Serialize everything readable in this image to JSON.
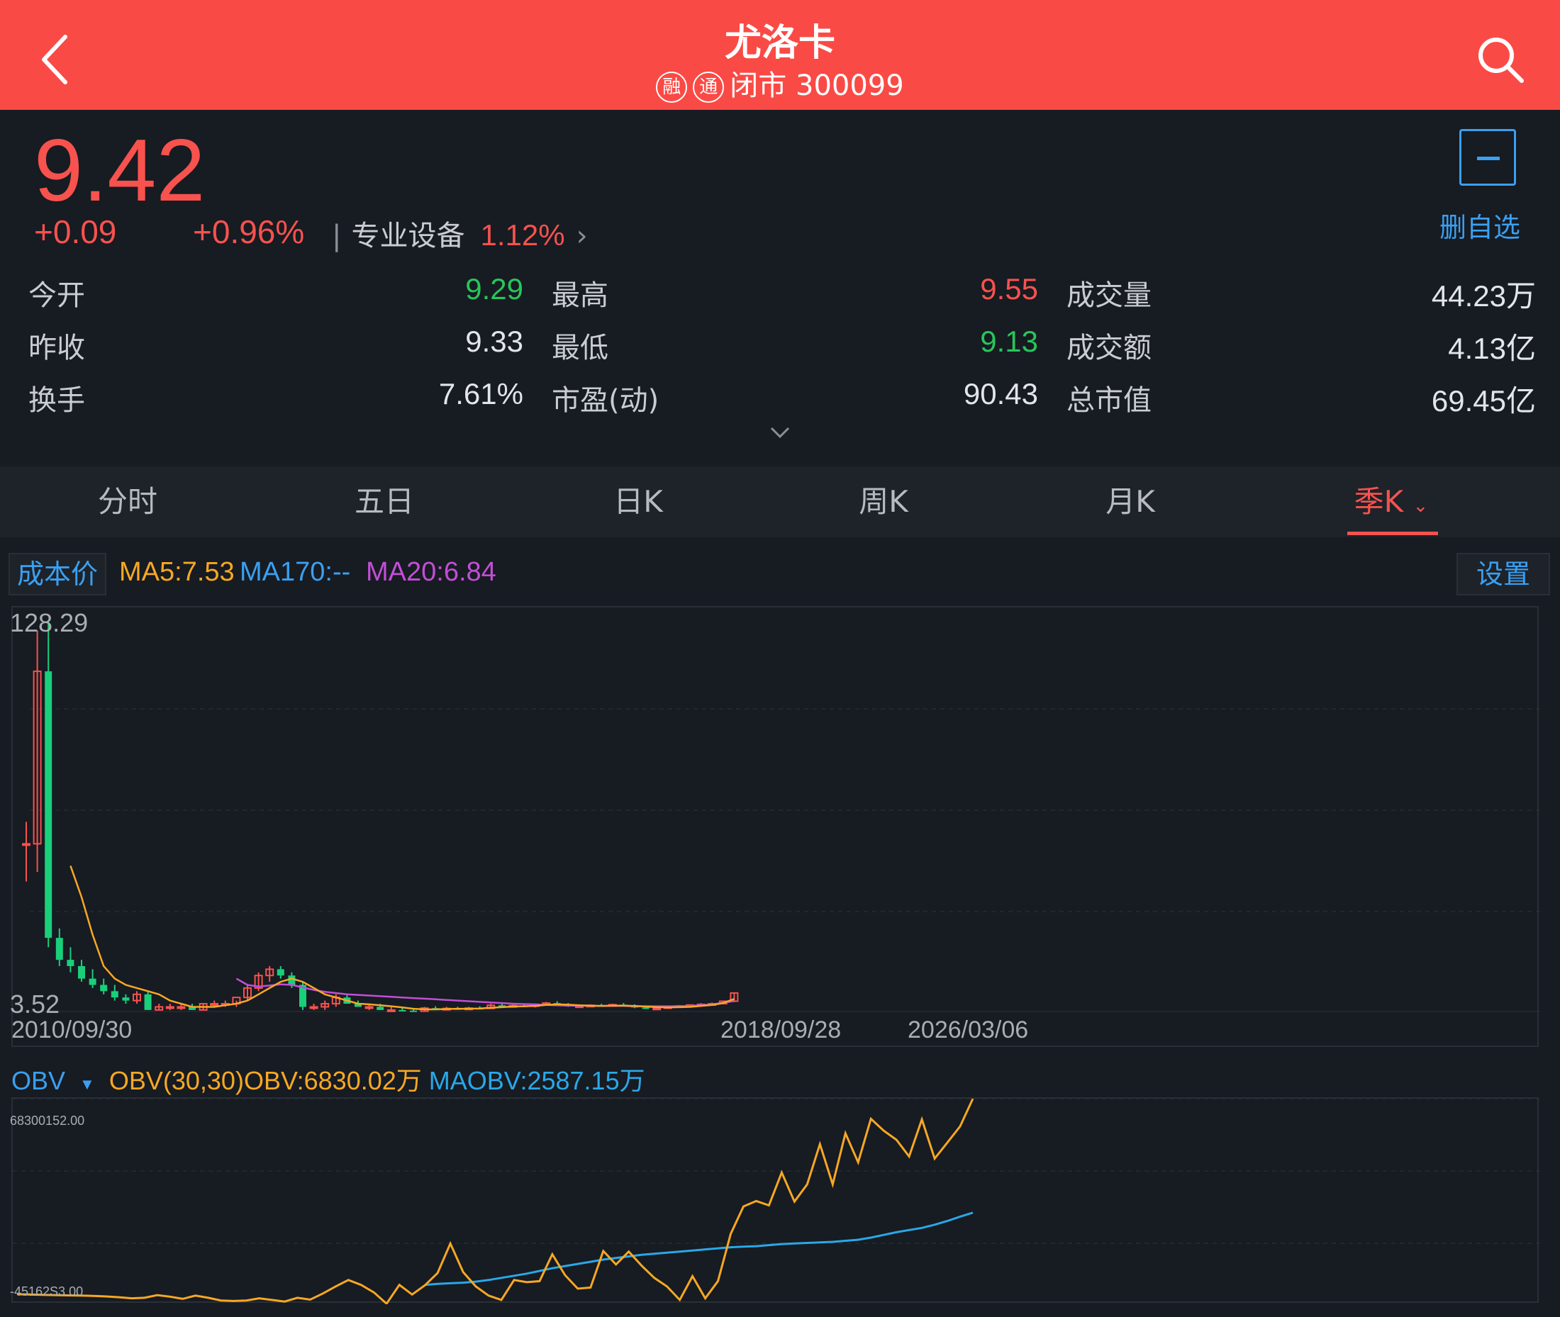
{
  "header": {
    "title": "尤洛卡",
    "badge1": "融",
    "badge2": "通",
    "subtitle": "闭市 300099"
  },
  "quote": {
    "price": "9.42",
    "change": "+0.09",
    "change_pct": "+0.96%",
    "sector_name": "专业设备",
    "sector_pct": "1.12%",
    "watch_label": "删自选"
  },
  "stats": [
    {
      "label": "今开",
      "value": "9.29",
      "color": "green"
    },
    {
      "label": "最高",
      "value": "9.55",
      "color": "red"
    },
    {
      "label": "成交量",
      "value": "44.23万",
      "color": "white"
    },
    {
      "label": "昨收",
      "value": "9.33",
      "color": "white"
    },
    {
      "label": "最低",
      "value": "9.13",
      "color": "green"
    },
    {
      "label": "成交额",
      "value": "4.13亿",
      "color": "white"
    },
    {
      "label": "换手",
      "value": "7.61%",
      "color": "white"
    },
    {
      "label": "市盈(动)",
      "value": "90.43",
      "color": "white"
    },
    {
      "label": "总市值",
      "value": "69.45亿",
      "color": "white"
    }
  ],
  "tabs": [
    "分时",
    "五日",
    "日K",
    "周K",
    "月K",
    "季K"
  ],
  "active_tab": "季K",
  "indicators": {
    "cost_label": "成本价",
    "ma5": "MA5:7.53",
    "ma170": "MA170:--",
    "ma20": "MA20:6.84",
    "settings_label": "设置"
  },
  "colors": {
    "up": "#f7524d",
    "down": "#19cf7a",
    "ma5": "#f7a823",
    "ma20": "#c24ed6",
    "obv": "#f7a823",
    "maobv": "#29a8e8",
    "accent": "#3aa0f0",
    "header": "#fa4a45"
  },
  "chart_data": [
    {
      "type": "candlestick",
      "ymax_label": "128.29",
      "ymin_label": "3.52",
      "ylim": [
        3.52,
        128.29
      ],
      "x_labels": [
        "2010/09/30",
        "2018/09/28",
        "2026/03/06"
      ],
      "candles": [
        [
          57,
          64,
          45,
          57
        ],
        [
          57,
          125,
          48,
          112
        ],
        [
          112,
          128.29,
          24,
          27
        ],
        [
          27,
          30,
          18,
          20
        ],
        [
          20,
          24,
          16,
          18
        ],
        [
          18,
          20,
          13,
          14
        ],
        [
          14,
          17,
          11,
          12
        ],
        [
          12,
          14,
          9,
          10
        ],
        [
          10,
          12,
          7,
          8
        ],
        [
          8,
          9,
          6,
          7
        ],
        [
          7,
          10,
          6,
          9
        ],
        [
          9,
          10,
          4,
          4
        ],
        [
          4,
          6,
          4,
          5
        ],
        [
          5,
          6,
          4,
          5
        ],
        [
          5,
          6,
          4,
          5
        ],
        [
          5,
          6,
          4,
          4
        ],
        [
          4,
          6,
          4,
          6
        ],
        [
          6,
          7,
          5,
          6
        ],
        [
          6,
          7,
          5,
          6
        ],
        [
          6,
          7,
          5,
          8
        ],
        [
          8,
          12,
          7,
          11
        ],
        [
          11,
          16,
          10,
          15
        ],
        [
          15,
          18,
          13,
          17
        ],
        [
          17,
          18,
          14,
          15
        ],
        [
          15,
          16,
          11,
          12
        ],
        [
          12,
          13,
          4,
          5
        ],
        [
          5,
          6,
          4,
          5
        ],
        [
          5,
          7,
          4,
          6
        ],
        [
          6,
          9,
          5,
          8
        ],
        [
          8,
          9,
          6,
          6
        ],
        [
          6,
          7,
          5,
          5
        ],
        [
          5,
          6,
          4,
          5
        ],
        [
          5,
          6,
          4,
          4
        ],
        [
          4,
          5,
          3.6,
          4
        ],
        [
          4,
          5,
          3.6,
          3.8
        ],
        [
          3.8,
          4.2,
          3.52,
          3.6
        ],
        [
          3.6,
          5,
          3.6,
          4.6
        ],
        [
          4.6,
          5.2,
          4.2,
          4.4
        ],
        [
          4.4,
          5,
          4,
          4.5
        ],
        [
          4.5,
          5,
          4.2,
          4.3
        ],
        [
          4.3,
          5,
          4.2,
          4.6
        ],
        [
          4.6,
          5.2,
          4.3,
          4.5
        ],
        [
          4.5,
          6,
          4.3,
          5.5
        ],
        [
          5.5,
          6.5,
          5,
          5.2
        ],
        [
          5.2,
          6.2,
          5,
          5.4
        ],
        [
          5.4,
          6,
          5,
          5.2
        ],
        [
          5.2,
          6,
          4.8,
          5.8
        ],
        [
          5.8,
          6.6,
          5.4,
          6.2
        ],
        [
          6.2,
          6.8,
          5.6,
          5.8
        ],
        [
          5.8,
          6.2,
          5,
          5.1
        ],
        [
          5.1,
          5.6,
          4.8,
          5.3
        ],
        [
          5.3,
          5.8,
          5,
          5.5
        ],
        [
          5.5,
          6,
          5.2,
          5.4
        ],
        [
          5.4,
          6,
          5.1,
          5.7
        ],
        [
          5.7,
          6.2,
          5.2,
          5.3
        ],
        [
          5.3,
          5.8,
          4.6,
          4.8
        ],
        [
          4.8,
          5.2,
          4.3,
          4.5
        ],
        [
          4.5,
          5,
          4.3,
          4.6
        ],
        [
          4.6,
          5.2,
          4.4,
          5.0
        ],
        [
          5.0,
          5.6,
          4.8,
          5.3
        ],
        [
          5.3,
          5.8,
          5.0,
          5.6
        ],
        [
          5.6,
          6.2,
          5.2,
          5.8
        ],
        [
          5.8,
          6.4,
          5.6,
          6.0
        ],
        [
          6.0,
          7.0,
          5.8,
          6.8
        ],
        [
          6.8,
          9.55,
          6.5,
          9.42
        ]
      ],
      "ma5": [
        null,
        null,
        null,
        null,
        50,
        40,
        28,
        18,
        14,
        12,
        11,
        10,
        9,
        7,
        6,
        5,
        5,
        5,
        5.5,
        6,
        7,
        9,
        11,
        13,
        14,
        13,
        11,
        9,
        8,
        7,
        6,
        5.8,
        5.5,
        5.2,
        4.8,
        4.4,
        4.2,
        4.2,
        4.3,
        4.4,
        4.4,
        4.5,
        4.7,
        4.9,
        5.1,
        5.2,
        5.3,
        5.6,
        5.8,
        5.7,
        5.5,
        5.4,
        5.3,
        5.4,
        5.4,
        5.3,
        5.1,
        4.9,
        4.8,
        4.9,
        5.0,
        5.3,
        5.6,
        6.2,
        7.53
      ],
      "ma20": [
        null,
        null,
        null,
        null,
        null,
        null,
        null,
        null,
        null,
        null,
        null,
        null,
        null,
        null,
        null,
        null,
        null,
        null,
        null,
        14,
        12,
        11.5,
        11.8,
        12.2,
        12,
        11.2,
        10.4,
        9.8,
        9.4,
        9.0,
        8.8,
        8.6,
        8.4,
        8.2,
        8.0,
        7.8,
        7.6,
        7.4,
        7.2,
        7.0,
        6.8,
        6.6,
        6.4,
        6.2,
        6.0,
        5.9,
        5.8,
        5.6,
        5.5,
        5.4,
        5.4,
        5.3,
        5.3,
        5.3,
        5.3,
        5.2,
        5.2,
        5.2,
        5.2,
        5.2,
        5.3,
        5.5,
        5.8,
        6.3,
        6.84
      ]
    },
    {
      "type": "line",
      "indicator_name": "OBV",
      "params": "OBV(30,30)",
      "obv_label": "OBV:6830.02万",
      "maobv_label": "MAOBV:2587.15万",
      "ymax_label": "68300152.00",
      "ymin_label": "-45162S3.00",
      "ylim": [
        -4516283,
        68300152
      ],
      "obv": [
        -4.5,
        -4.6,
        -4.7,
        -4.8,
        -4.9,
        -5.0,
        -5.1,
        -5.3,
        -5.6,
        -6.0,
        -5.8,
        -4.8,
        -5.4,
        -6.2,
        -5.0,
        -5.8,
        -6.8,
        -7.0,
        -6.8,
        -6.0,
        -6.6,
        -7.2,
        -5.8,
        -6.5,
        -4.2,
        -1.6,
        0.8,
        -1.0,
        -3.8,
        -8.0,
        -1.0,
        -4.6,
        -1.2,
        3.4,
        14.4,
        3.8,
        -1.6,
        -5.0,
        -6.6,
        0.8,
        0.0,
        0.4,
        10.4,
        2.6,
        -2.4,
        -2.0,
        11.6,
        6.6,
        11.4,
        6.2,
        1.6,
        -1.6,
        -6.6,
        2.2,
        -6.0,
        0.4,
        18.0,
        28.2,
        30.2,
        28.6,
        40.8,
        30.0,
        36.4,
        51.4,
        36.4,
        55.4,
        44.6,
        60.8,
        56.4,
        53.0,
        46.8,
        60.6,
        46.0,
        52.0,
        58.0,
        68.3
      ],
      "maobv": [
        null,
        null,
        null,
        null,
        null,
        null,
        null,
        null,
        null,
        null,
        null,
        null,
        null,
        null,
        null,
        null,
        null,
        null,
        null,
        null,
        null,
        null,
        null,
        null,
        null,
        null,
        null,
        null,
        null,
        null,
        null,
        null,
        -1.0,
        -0.6,
        -0.4,
        -0.2,
        0.2,
        0.8,
        1.6,
        2.4,
        3.2,
        4.2,
        5.2,
        6.0,
        6.8,
        7.6,
        8.4,
        9.0,
        9.6,
        10.2,
        10.6,
        11.0,
        11.4,
        11.8,
        12.2,
        12.6,
        13.0,
        13.2,
        13.4,
        13.8,
        14.2,
        14.4,
        14.6,
        14.8,
        15.0,
        15.4,
        15.8,
        16.6,
        17.6,
        18.6,
        19.4,
        20.2,
        21.4,
        22.8,
        24.4,
        25.87
      ]
    }
  ]
}
